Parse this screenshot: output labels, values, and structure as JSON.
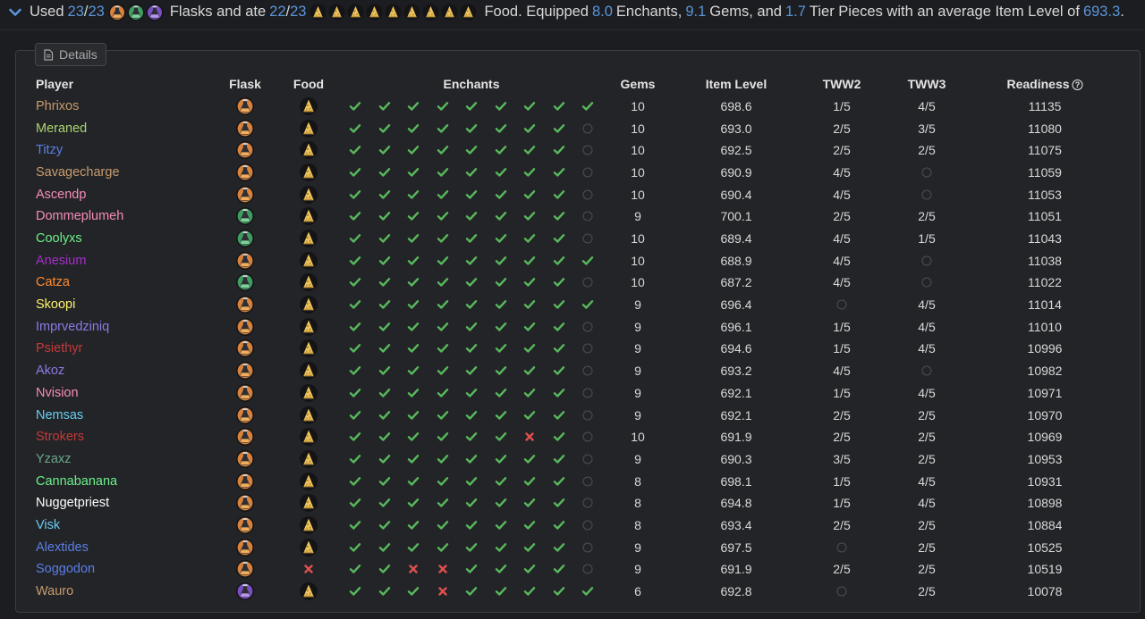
{
  "summary": {
    "used": "Used",
    "flasks_used": "23",
    "sep1": "/",
    "flasks_total": "23",
    "flasks_and_ate": "Flasks and ate",
    "food_used": "22",
    "sep2": "/",
    "food_total": "23",
    "food_equipped": "Food. Equipped",
    "enchants": "8.0",
    "enchants_label": "Enchants,",
    "gems": "9.1",
    "gems_label": "Gems, and",
    "tier": "1.7",
    "tier_label": "Tier Pieces with an average Item Level of",
    "ilvl": "693.3",
    "period": ".",
    "flask_icons": [
      "flask-orange-icon",
      "flask-green-icon",
      "flask-purple-icon"
    ],
    "food_icon_count": 9
  },
  "details_tab": {
    "label": "Details",
    "icon": "document-icon"
  },
  "headers": {
    "player": "Player",
    "flask": "Flask",
    "food": "Food",
    "enchants": "Enchants",
    "gems": "Gems",
    "ilvl": "Item Level",
    "tww2": "TWW2",
    "tww3": "TWW3",
    "readiness": "Readiness",
    "readiness_info_icon": "?"
  },
  "status_colors": {
    "check": "#58b85c",
    "cross": "#e05050",
    "empty": "#4d4e53",
    "link": "#5b95d8"
  },
  "rows": [
    {
      "player": "Phrixos",
      "color": "#c79c6e",
      "flask": "orange",
      "food": "yes",
      "enchants": [
        "y",
        "y",
        "y",
        "y",
        "y",
        "y",
        "y",
        "y",
        "y"
      ],
      "gems": "10",
      "ilvl": "698.6",
      "tww2": "1/5",
      "tww3": "4/5",
      "readiness": "11135"
    },
    {
      "player": "Meraned",
      "color": "#abd473",
      "flask": "orange",
      "food": "yes",
      "enchants": [
        "y",
        "y",
        "y",
        "y",
        "y",
        "y",
        "y",
        "y",
        "n"
      ],
      "gems": "10",
      "ilvl": "693.0",
      "tww2": "2/5",
      "tww3": "3/5",
      "readiness": "11080"
    },
    {
      "player": "Titzy",
      "color": "#5a7ee6",
      "flask": "orange",
      "food": "yes",
      "enchants": [
        "y",
        "y",
        "y",
        "y",
        "y",
        "y",
        "y",
        "y",
        "n"
      ],
      "gems": "10",
      "ilvl": "692.5",
      "tww2": "2/5",
      "tww3": "2/5",
      "readiness": "11075"
    },
    {
      "player": "Savagecharge",
      "color": "#c79c6e",
      "flask": "orange",
      "food": "yes",
      "enchants": [
        "y",
        "y",
        "y",
        "y",
        "y",
        "y",
        "y",
        "y",
        "n"
      ],
      "gems": "10",
      "ilvl": "690.9",
      "tww2": "4/5",
      "tww3": "",
      "readiness": "11059"
    },
    {
      "player": "Ascendp",
      "color": "#f58cba",
      "flask": "orange",
      "food": "yes",
      "enchants": [
        "y",
        "y",
        "y",
        "y",
        "y",
        "y",
        "y",
        "y",
        "n"
      ],
      "gems": "10",
      "ilvl": "690.4",
      "tww2": "4/5",
      "tww3": "",
      "readiness": "11053"
    },
    {
      "player": "Dommeplumeh",
      "color": "#f58cba",
      "flask": "green",
      "food": "yes",
      "enchants": [
        "y",
        "y",
        "y",
        "y",
        "y",
        "y",
        "y",
        "y",
        "n"
      ],
      "gems": "9",
      "ilvl": "700.1",
      "tww2": "2/5",
      "tww3": "2/5",
      "readiness": "11051"
    },
    {
      "player": "Coolyxs",
      "color": "#6cf08a",
      "flask": "green",
      "food": "yes",
      "enchants": [
        "y",
        "y",
        "y",
        "y",
        "y",
        "y",
        "y",
        "y",
        "n"
      ],
      "gems": "10",
      "ilvl": "689.4",
      "tww2": "4/5",
      "tww3": "1/5",
      "readiness": "11043"
    },
    {
      "player": "Anesium",
      "color": "#a330c9",
      "flask": "orange",
      "food": "yes",
      "enchants": [
        "y",
        "y",
        "y",
        "y",
        "y",
        "y",
        "y",
        "y",
        "y"
      ],
      "gems": "10",
      "ilvl": "688.9",
      "tww2": "4/5",
      "tww3": "",
      "readiness": "11038"
    },
    {
      "player": "Catza",
      "color": "#ff8a2e",
      "flask": "green",
      "food": "yes",
      "enchants": [
        "y",
        "y",
        "y",
        "y",
        "y",
        "y",
        "y",
        "y",
        "n"
      ],
      "gems": "10",
      "ilvl": "687.2",
      "tww2": "4/5",
      "tww3": "",
      "readiness": "11022"
    },
    {
      "player": "Skoopi",
      "color": "#fff36a",
      "flask": "orange",
      "food": "yes",
      "enchants": [
        "y",
        "y",
        "y",
        "y",
        "y",
        "y",
        "y",
        "y",
        "y"
      ],
      "gems": "9",
      "ilvl": "696.4",
      "tww2": "",
      "tww3": "4/5",
      "readiness": "11014"
    },
    {
      "player": "Imprvedziniq",
      "color": "#8c7ae6",
      "flask": "orange",
      "food": "yes",
      "enchants": [
        "y",
        "y",
        "y",
        "y",
        "y",
        "y",
        "y",
        "y",
        "n"
      ],
      "gems": "9",
      "ilvl": "696.1",
      "tww2": "1/5",
      "tww3": "4/5",
      "readiness": "11010"
    },
    {
      "player": "Psiethyr",
      "color": "#c43a3a",
      "flask": "orange",
      "food": "yes",
      "enchants": [
        "y",
        "y",
        "y",
        "y",
        "y",
        "y",
        "y",
        "y",
        "n"
      ],
      "gems": "9",
      "ilvl": "694.6",
      "tww2": "1/5",
      "tww3": "4/5",
      "readiness": "10996"
    },
    {
      "player": "Akoz",
      "color": "#8c7ae6",
      "flask": "orange",
      "food": "yes",
      "enchants": [
        "y",
        "y",
        "y",
        "y",
        "y",
        "y",
        "y",
        "y",
        "n"
      ],
      "gems": "9",
      "ilvl": "693.2",
      "tww2": "4/5",
      "tww3": "",
      "readiness": "10982"
    },
    {
      "player": "Nvision",
      "color": "#f58cba",
      "flask": "orange",
      "food": "yes",
      "enchants": [
        "y",
        "y",
        "y",
        "y",
        "y",
        "y",
        "y",
        "y",
        "n"
      ],
      "gems": "9",
      "ilvl": "692.1",
      "tww2": "1/5",
      "tww3": "4/5",
      "readiness": "10971"
    },
    {
      "player": "Nemsas",
      "color": "#69ccf0",
      "flask": "orange",
      "food": "yes",
      "enchants": [
        "y",
        "y",
        "y",
        "y",
        "y",
        "y",
        "y",
        "y",
        "n"
      ],
      "gems": "9",
      "ilvl": "692.1",
      "tww2": "2/5",
      "tww3": "2/5",
      "readiness": "10970"
    },
    {
      "player": "Strokers",
      "color": "#c43a3a",
      "flask": "orange",
      "food": "yes",
      "enchants": [
        "y",
        "y",
        "y",
        "y",
        "y",
        "y",
        "n",
        "y",
        "n"
      ],
      "gems": "10",
      "ilvl": "691.9",
      "tww2": "2/5",
      "tww3": "2/5",
      "readiness": "10969"
    },
    {
      "player": "Yzaxz",
      "color": "#6aa88a",
      "flask": "orange",
      "food": "yes",
      "enchants": [
        "y",
        "y",
        "y",
        "y",
        "y",
        "y",
        "y",
        "y",
        "n"
      ],
      "gems": "9",
      "ilvl": "690.3",
      "tww2": "3/5",
      "tww3": "2/5",
      "readiness": "10953"
    },
    {
      "player": "Cannabanana",
      "color": "#6cf08a",
      "flask": "orange",
      "food": "yes",
      "enchants": [
        "y",
        "y",
        "y",
        "y",
        "y",
        "y",
        "y",
        "y",
        "n"
      ],
      "gems": "8",
      "ilvl": "698.1",
      "tww2": "1/5",
      "tww3": "4/5",
      "readiness": "10931"
    },
    {
      "player": "Nuggetpriest",
      "color": "#ffffff",
      "flask": "orange",
      "food": "yes",
      "enchants": [
        "y",
        "y",
        "y",
        "y",
        "y",
        "y",
        "y",
        "y",
        "n"
      ],
      "gems": "8",
      "ilvl": "694.8",
      "tww2": "1/5",
      "tww3": "4/5",
      "readiness": "10898"
    },
    {
      "player": "Visk",
      "color": "#69ccf0",
      "flask": "orange",
      "food": "yes",
      "enchants": [
        "y",
        "y",
        "y",
        "y",
        "y",
        "y",
        "y",
        "y",
        "n"
      ],
      "gems": "8",
      "ilvl": "693.4",
      "tww2": "2/5",
      "tww3": "2/5",
      "readiness": "10884"
    },
    {
      "player": "Alextides",
      "color": "#5a7ee6",
      "flask": "orange",
      "food": "yes",
      "enchants": [
        "y",
        "y",
        "y",
        "y",
        "y",
        "y",
        "y",
        "y",
        "n"
      ],
      "gems": "9",
      "ilvl": "697.5",
      "tww2": "",
      "tww3": "2/5",
      "readiness": "10525"
    },
    {
      "player": "Soggodon",
      "color": "#5a7ee6",
      "flask": "orange",
      "food": "no",
      "enchants": [
        "y",
        "y",
        "n",
        "n",
        "y",
        "y",
        "y",
        "y",
        "n"
      ],
      "gems": "9",
      "ilvl": "691.9",
      "tww2": "2/5",
      "tww3": "2/5",
      "readiness": "10519"
    },
    {
      "player": "Wauro",
      "color": "#c79c6e",
      "flask": "purple",
      "food": "yes",
      "enchants": [
        "y",
        "y",
        "y",
        "n",
        "y",
        "y",
        "y",
        "y",
        "y"
      ],
      "gems": "6",
      "ilvl": "692.8",
      "tww2": "",
      "tww3": "2/5",
      "readiness": "10078"
    }
  ]
}
